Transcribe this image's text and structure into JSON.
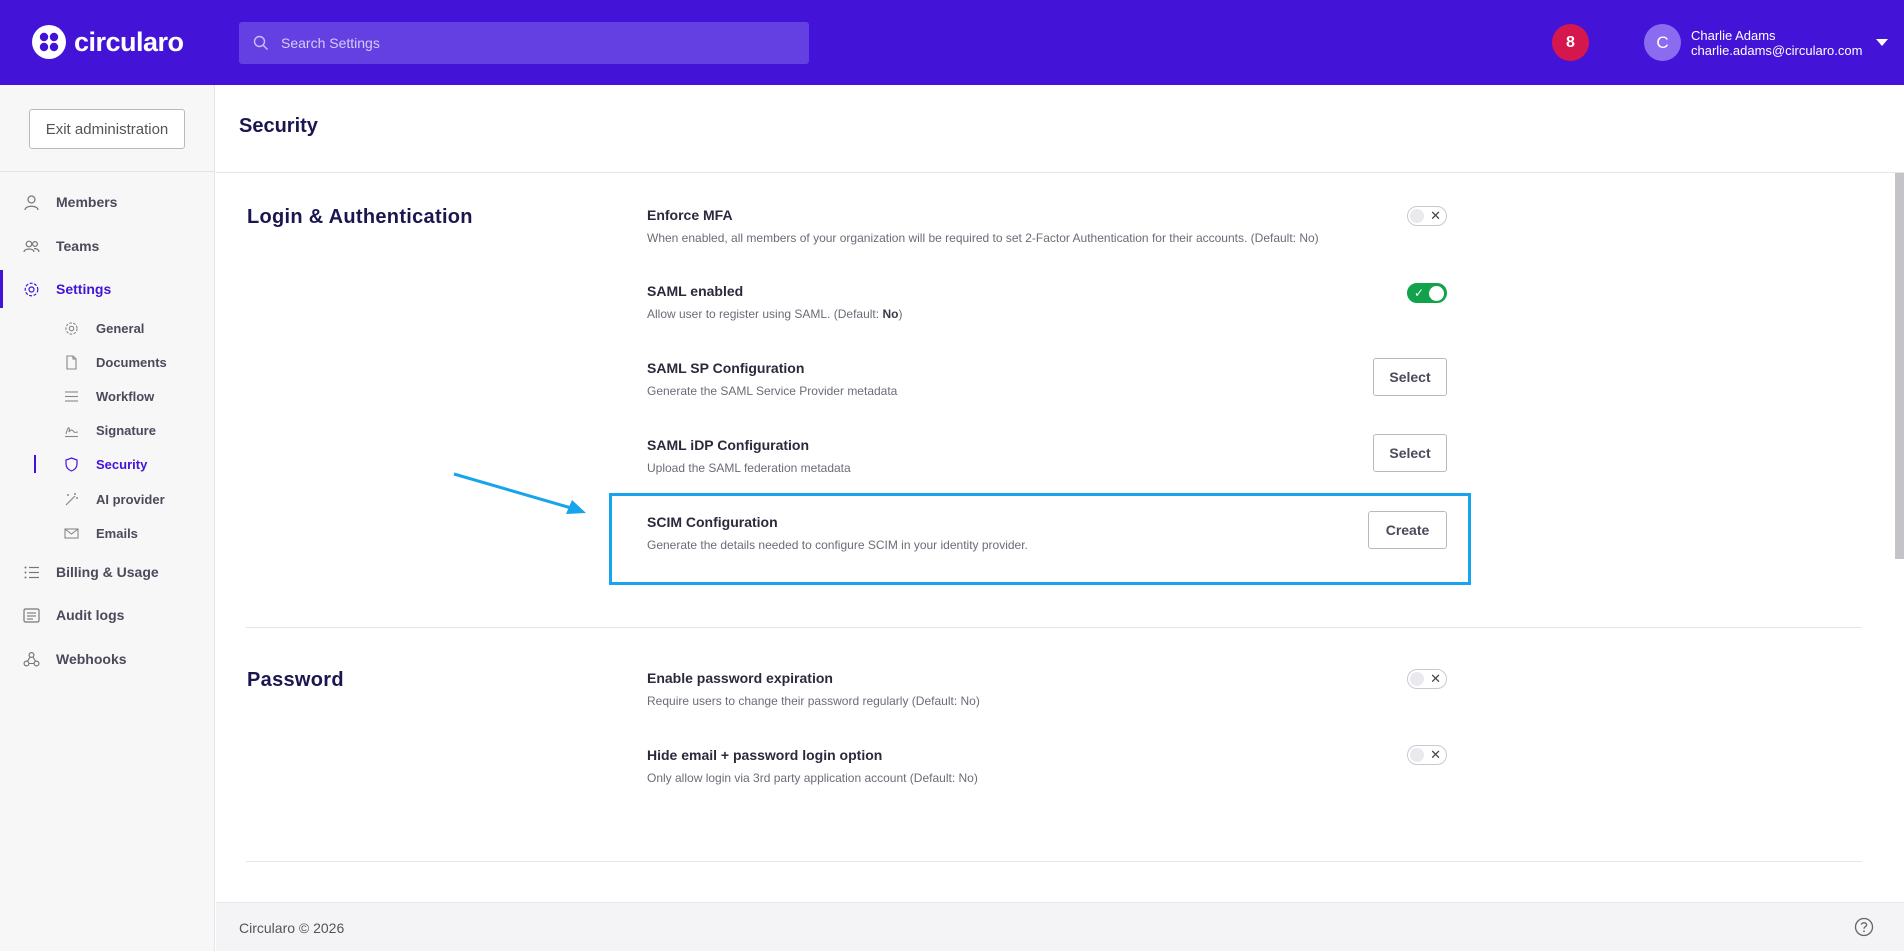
{
  "brand": {
    "name": "circularo",
    "accent": "#4313d8",
    "alert": "#d6174d",
    "highlight": "#18a4ec"
  },
  "search": {
    "placeholder": "Search Settings",
    "icon": "search-icon"
  },
  "notifications": {
    "count": "8"
  },
  "user": {
    "initial": "C",
    "name": "Charlie Adams",
    "email": "charlie.adams@circularo.com"
  },
  "sidebar": {
    "exit_label": "Exit administration",
    "items": [
      {
        "label": "Members",
        "icon": "user-icon"
      },
      {
        "label": "Teams",
        "icon": "users-icon"
      },
      {
        "label": "Settings",
        "icon": "gear-icon"
      },
      {
        "label": "Billing & Usage",
        "icon": "list-icon"
      },
      {
        "label": "Audit logs",
        "icon": "log-icon"
      },
      {
        "label": "Webhooks",
        "icon": "webhook-icon"
      }
    ],
    "settings_sub": [
      {
        "label": "General",
        "icon": "gear-icon"
      },
      {
        "label": "Documents",
        "icon": "document-icon"
      },
      {
        "label": "Workflow",
        "icon": "workflow-icon"
      },
      {
        "label": "Signature",
        "icon": "signature-icon"
      },
      {
        "label": "Security",
        "icon": "shield-icon"
      },
      {
        "label": "AI provider",
        "icon": "wand-icon"
      },
      {
        "label": "Emails",
        "icon": "mail-icon"
      }
    ]
  },
  "page": {
    "title": "Security"
  },
  "sections": {
    "login": {
      "title": "Login & Authentication",
      "settings": [
        {
          "title": "Enforce MFA",
          "desc": "When enabled, all members of your organization will be required to set 2-Factor Authentication for their accounts.  (Default: No)",
          "state": "off"
        },
        {
          "title": "SAML enabled",
          "desc": "Allow user to register using SAML.  (Default: ",
          "desc_bold": "No",
          "desc_end": ")",
          "state": "on"
        },
        {
          "title": "SAML SP Configuration",
          "desc": "Generate the SAML Service Provider metadata",
          "button": "Select"
        },
        {
          "title": "SAML iDP Configuration",
          "desc": "Upload the SAML federation metadata",
          "button": "Select"
        },
        {
          "title": "SCIM Configuration",
          "desc": "Generate the details needed to configure SCIM in your identity provider.",
          "button": "Create"
        }
      ]
    },
    "password": {
      "title": "Password",
      "settings": [
        {
          "title": "Enable password expiration",
          "desc": "Require users to change their password regularly  (Default: No)",
          "state": "off"
        },
        {
          "title": "Hide email + password login option",
          "desc": "Only allow login via 3rd party application account  (Default: No)",
          "state": "off"
        }
      ]
    }
  },
  "toggle_marks": {
    "off": "✕",
    "on": "✓"
  },
  "footer": {
    "text": "Circularo © 2026",
    "help_icon": "help-icon"
  }
}
